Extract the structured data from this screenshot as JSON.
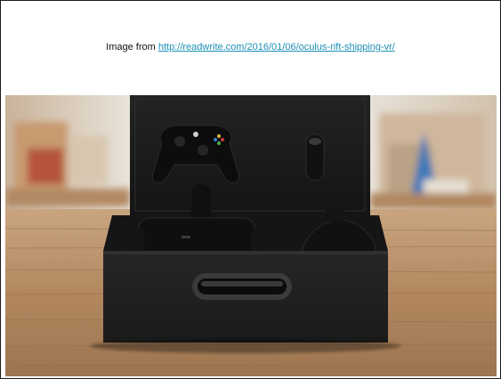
{
  "caption": {
    "prefix": "Image from ",
    "link_text": "http://readwrite.com/2016/01/06/oculus-rift-shipping-vr/"
  },
  "photo": {
    "subject": "Oculus Rift retail box with headset, sensor, remote and Xbox controller",
    "colors": {
      "box": "#1c1c1c",
      "table": "#b38860",
      "background_wall": "#d9d4cc",
      "accent_blue": "#3e78b8"
    }
  }
}
